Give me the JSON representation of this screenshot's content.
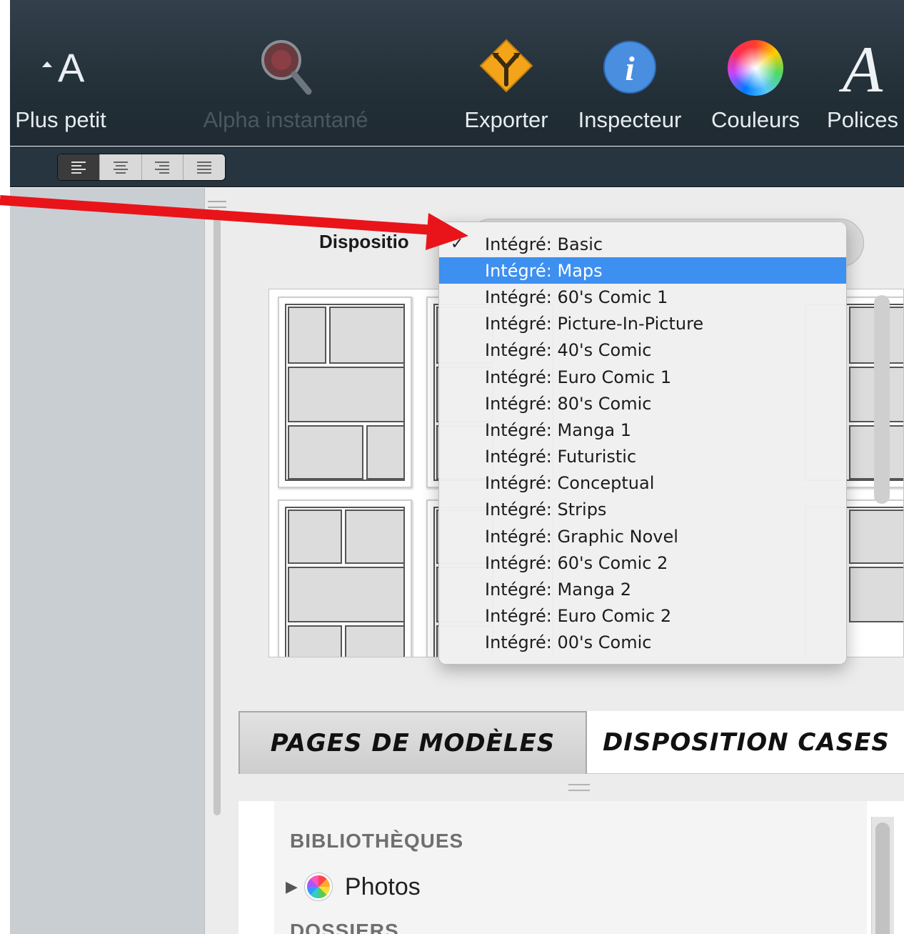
{
  "toolbar": {
    "items": [
      {
        "label": "Plus petit",
        "icon": "smaller-font-icon",
        "enabled": true
      },
      {
        "label": "Alpha instantané",
        "icon": "instant-alpha-icon",
        "enabled": false
      },
      {
        "label": "Exporter",
        "icon": "export-icon",
        "enabled": true
      },
      {
        "label": "Inspecteur",
        "icon": "inspector-icon",
        "enabled": true
      },
      {
        "label": "Couleurs",
        "icon": "colors-icon",
        "enabled": true
      },
      {
        "label": "Polices",
        "icon": "fonts-icon",
        "enabled": true
      }
    ],
    "alignment_buttons": [
      "align-left",
      "align-center",
      "align-right",
      "justify"
    ],
    "selected_alignment": "align-left"
  },
  "main": {
    "disposition_label": "Dispositio"
  },
  "dropdown": {
    "checked_item": "Intégré: Basic",
    "highlighted_item": "Intégré: Maps",
    "items": [
      "Intégré: Basic",
      "Intégré: Maps",
      "Intégré: 60's Comic 1",
      "Intégré: Picture-In-Picture",
      "Intégré: 40's Comic",
      "Intégré: Euro Comic 1",
      "Intégré: 80's Comic",
      "Intégré: Manga 1",
      "Intégré: Futuristic",
      "Intégré: Conceptual",
      "Intégré: Strips",
      "Intégré: Graphic Novel",
      "Intégré: 60's Comic 2",
      "Intégré: Manga 2",
      "Intégré: Euro Comic 2",
      "Intégré: 00's Comic"
    ]
  },
  "tabs": [
    {
      "label": "PAGES DE MODÈLES",
      "active": true
    },
    {
      "label": "DISPOSITION CASES",
      "active": false
    }
  ],
  "browser": {
    "section_header": "BIBLIOTHÈQUES",
    "items": [
      {
        "label": "Photos",
        "icon": "photos-icon"
      }
    ],
    "next_section_partial": "DOSSIERS"
  },
  "colors": {
    "highlight": "#3d8ff0",
    "annotation_arrow": "#e8141a"
  }
}
